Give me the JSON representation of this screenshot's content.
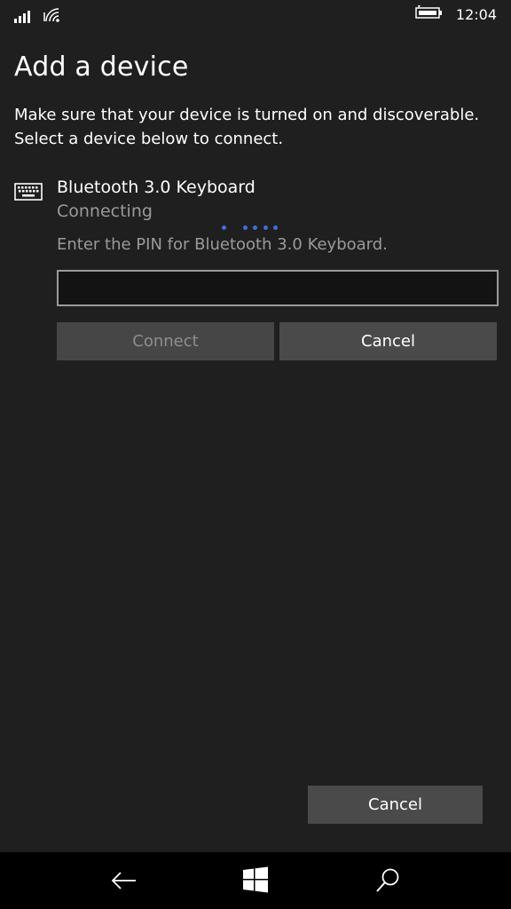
{
  "status_bar": {
    "time": "12:04",
    "icons": [
      "signal-icon",
      "wifi-icon",
      "battery-charging-icon"
    ]
  },
  "page": {
    "title": "Add a device",
    "description_line1": "Make sure that your device is turned on and discoverable.",
    "description_line2": "Select a device below to connect."
  },
  "device": {
    "icon": "keyboard-icon",
    "name": "Bluetooth 3.0 Keyboard",
    "status": "Connecting",
    "pin_prompt": "Enter the PIN for Bluetooth 3.0 Keyboard.",
    "pin_value": "",
    "connect_label": "Connect",
    "cancel_label": "Cancel"
  },
  "footer": {
    "cancel_label": "Cancel"
  },
  "nav": {
    "icons": [
      "back-arrow-icon",
      "windows-start-icon",
      "search-icon"
    ]
  },
  "colors": {
    "background": "#1f1f1f",
    "accent": "#3d6fe0",
    "button": "#4a4a4a",
    "nav_bar": "#000000"
  }
}
